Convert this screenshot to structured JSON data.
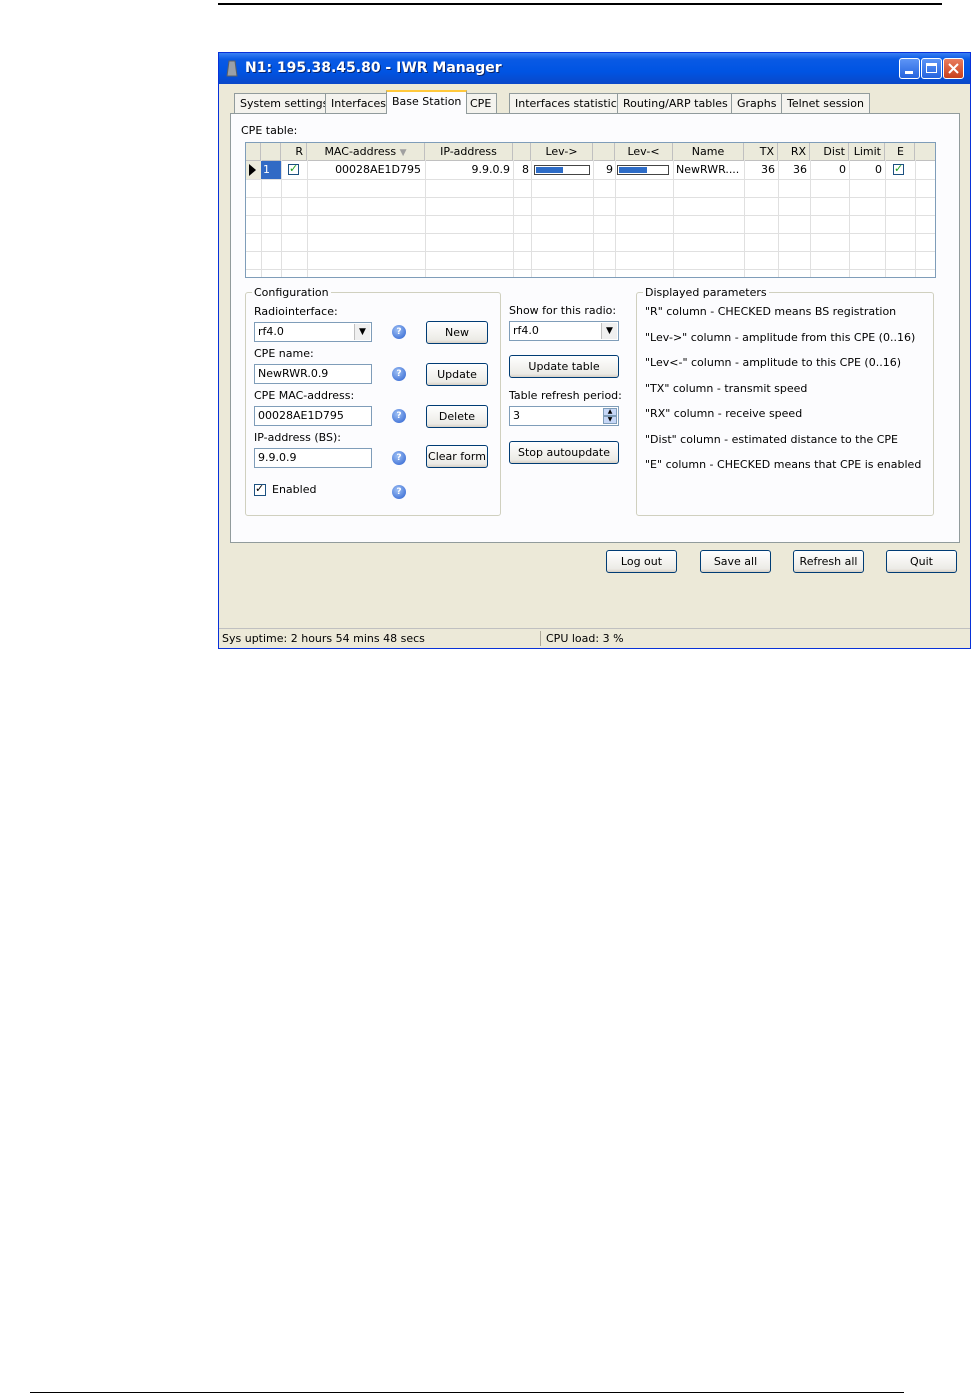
{
  "window": {
    "title": "N1: 195.38.45.80 - IWR Manager"
  },
  "tabs": [
    {
      "label": "System settings"
    },
    {
      "label": "Interfaces"
    },
    {
      "label": "Base Station",
      "active": true
    },
    {
      "label": "CPE"
    },
    {
      "label": "Interfaces statistics"
    },
    {
      "label": "Routing/ARP tables"
    },
    {
      "label": "Graphs"
    },
    {
      "label": "Telnet session"
    }
  ],
  "cpe_table": {
    "label": "CPE table:",
    "columns": [
      "R",
      "MAC-address",
      "IP-address",
      "Lev->",
      "Lev-<",
      "Name",
      "TX",
      "RX",
      "Dist",
      "Limit",
      "E"
    ],
    "rows": [
      {
        "index": "1",
        "r_checked": true,
        "mac": "00028AE1D795",
        "ip": "9.9.0.9",
        "lev_out": "8",
        "lev_out_fraction": 0.5,
        "lev_in": "9",
        "lev_in_fraction": 0.5625,
        "name": "NewRWR....",
        "tx": "36",
        "rx": "36",
        "dist": "0",
        "limit": "0",
        "e_checked": true
      }
    ]
  },
  "configuration": {
    "legend": "Configuration",
    "radio_label": "Radiointerface:",
    "radio_value": "rf4.0",
    "cpe_name_label": "CPE name:",
    "cpe_name_value": "NewRWR.0.9",
    "mac_label": "CPE MAC-address:",
    "mac_value": "00028AE1D795",
    "ip_label": "IP-address (BS):",
    "ip_value": "9.9.0.9",
    "enabled_label": "Enabled",
    "enabled_checked": true,
    "buttons": {
      "new": "New",
      "update": "Update",
      "delete": "Delete",
      "clear": "Clear form"
    }
  },
  "display": {
    "show_radio_label": "Show for this radio:",
    "show_radio_value": "rf4.0",
    "update_table": "Update table",
    "refresh_label": "Table refresh period:",
    "refresh_value": "3",
    "stop_autoupdate": "Stop autoupdate"
  },
  "params": {
    "legend": "Displayed parameters",
    "lines": [
      "\"R\" column - CHECKED means BS registration",
      "\"Lev->\" column - amplitude from this CPE (0..16)",
      "\"Lev<-\" column - amplitude to this CPE (0..16)",
      "\"TX\" column - transmit speed",
      "\"RX\" column - receive speed",
      "\"Dist\" column - estimated distance to the CPE",
      "\"E\" column - CHECKED means  that CPE is enabled"
    ]
  },
  "bottom_buttons": {
    "logout": "Log out",
    "save_all": "Save all",
    "refresh_all": "Refresh all",
    "quit": "Quit"
  },
  "status": {
    "uptime": "Sys uptime: 2 hours 54 mins 48 secs",
    "cpu": "CPU load: 3 %"
  },
  "help_icon": "?"
}
